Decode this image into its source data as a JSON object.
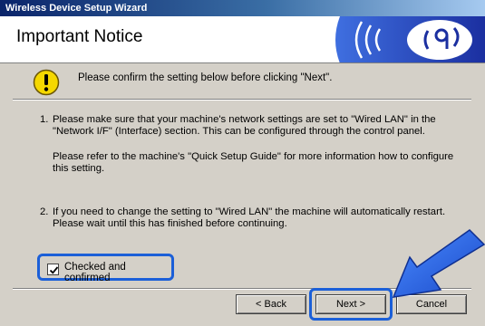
{
  "window": {
    "title": "Wireless Device Setup Wizard"
  },
  "header": {
    "title": "Important Notice",
    "logo_icon": "wireless-signal-icon"
  },
  "notice": {
    "icon": "warning-icon",
    "text": "Please confirm the setting below before clicking \"Next\"."
  },
  "instructions": {
    "item1_number": "1.",
    "item1_text": "Please make sure that your machine's network settings are set to \"Wired LAN\" in the \"Network I/F\" (Interface) section. This can be configured through the control panel.",
    "item1_note": "Please refer to the machine's \"Quick Setup Guide\" for more information how to configure this setting.",
    "item2_number": "2.",
    "item2_text": "If you need to change the setting to \"Wired LAN\" the machine will automatically restart. Please wait until this has finished before continuing."
  },
  "confirm": {
    "label": "Checked and confirmed",
    "checked": true
  },
  "buttons": {
    "back": "< Back",
    "next": "Next >",
    "cancel": "Cancel"
  },
  "colors": {
    "highlight": "#1b5fd8",
    "title_bar": "#0a246a",
    "warning": "#f5d800"
  }
}
